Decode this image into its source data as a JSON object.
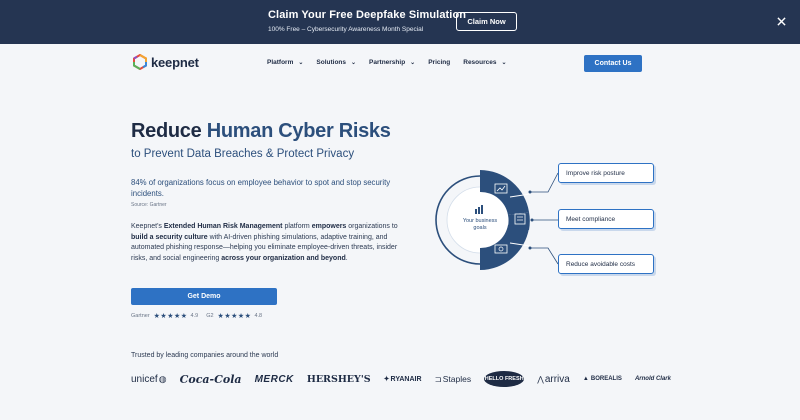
{
  "banner": {
    "title": "Claim Your Free Deepfake Simulation",
    "subtitle": "100% Free – Cybersecurity Awareness Month Special",
    "cta": "Claim Now",
    "close_icon": "close-icon"
  },
  "header": {
    "logo_text": "keepnet",
    "nav": [
      {
        "label": "Platform",
        "has_dropdown": true
      },
      {
        "label": "Solutions",
        "has_dropdown": true
      },
      {
        "label": "Partnership",
        "has_dropdown": true
      },
      {
        "label": "Pricing",
        "has_dropdown": false
      },
      {
        "label": "Resources",
        "has_dropdown": true
      }
    ],
    "contact_label": "Contact Us"
  },
  "hero": {
    "title_part1": "Reduce ",
    "title_part2": "Human Cyber Risks",
    "subtitle": "to Prevent Data Breaches & Protect Privacy",
    "stat": "84% of organizations focus on employee behavior to spot and stop security incidents.",
    "source": "Source: Gartner",
    "desc": {
      "t1": "Keepnet's ",
      "b1": "Extended Human Risk Management",
      "t2": " platform ",
      "b2": "empowers",
      "t3": " organizations to ",
      "b3": "build a security culture",
      "t4": " with AI-driven phishing simulations, adaptive training, and automated phishing response—helping you eliminate employee-driven threats, insider risks, and social engineering ",
      "b4": "across your organization and beyond",
      "t5": "."
    },
    "demo_label": "Get Demo",
    "ratings": [
      {
        "label": "Gartner",
        "stars": "★★★★★",
        "score": "4.9"
      },
      {
        "label": "G2",
        "stars": "★★★★★",
        "score": "4.8"
      }
    ]
  },
  "diagram": {
    "center_label_1": "Your business",
    "center_label_2": "goals",
    "outcomes": [
      "Improve risk posture",
      "Meet compliance",
      "Reduce avoidable costs"
    ],
    "colors": {
      "dark": "#2c4f7c",
      "accent": "#2e72c4"
    }
  },
  "trusted": {
    "label": "Trusted by leading companies around the world",
    "brands": [
      "unicef",
      "Coca-Cola",
      "MERCK",
      "HERSHEY'S",
      "RYANAIR",
      "Staples",
      "HELLO FRESH",
      "arriva",
      "BOREALIS",
      "Arnold Clark"
    ]
  }
}
